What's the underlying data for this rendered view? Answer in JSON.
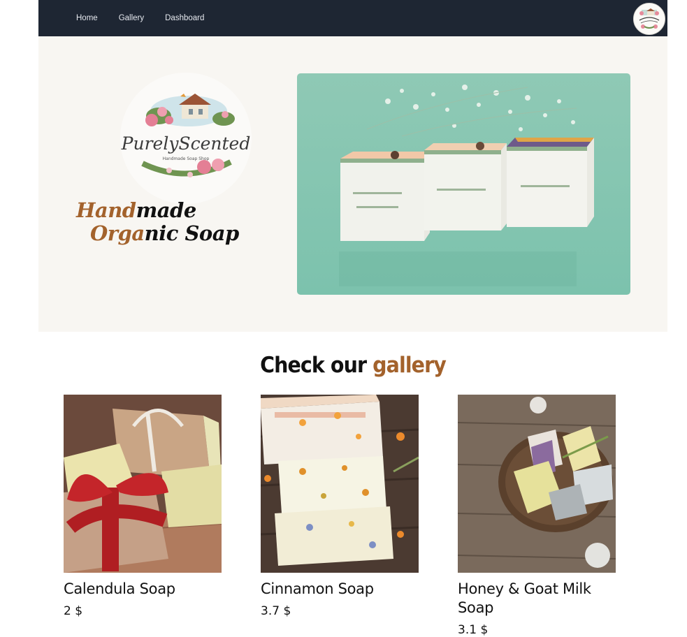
{
  "nav": {
    "links": [
      "Home",
      "Gallery",
      "Dashboard"
    ],
    "logo_icon": "purelyscented-logo"
  },
  "hero": {
    "logo_text": "PurelyScented",
    "logo_subtext": "Handmade Soap Shop",
    "tagline_line1_accent": "Hand",
    "tagline_line1_rest": "made",
    "tagline_line2_accent": "Orga",
    "tagline_line2_rest": "nic Soap",
    "image_icon": "soap-bars-photo"
  },
  "gallery": {
    "title_prefix": "Check our ",
    "title_accent": "gallery",
    "products": [
      {
        "name": "Calendula Soap",
        "price": "2 $",
        "image_icon": "calendula-soap-photo"
      },
      {
        "name": "Cinnamon Soap",
        "price": "3.7 $",
        "image_icon": "cinnamon-soap-photo"
      },
      {
        "name": "Honey & Goat Milk Soap",
        "price": "3.1 $",
        "image_icon": "honey-goat-milk-soap-photo"
      }
    ]
  },
  "colors": {
    "navbar": "#1e2633",
    "accent": "#a3622c",
    "hero_bg": "#f8f6f2"
  }
}
